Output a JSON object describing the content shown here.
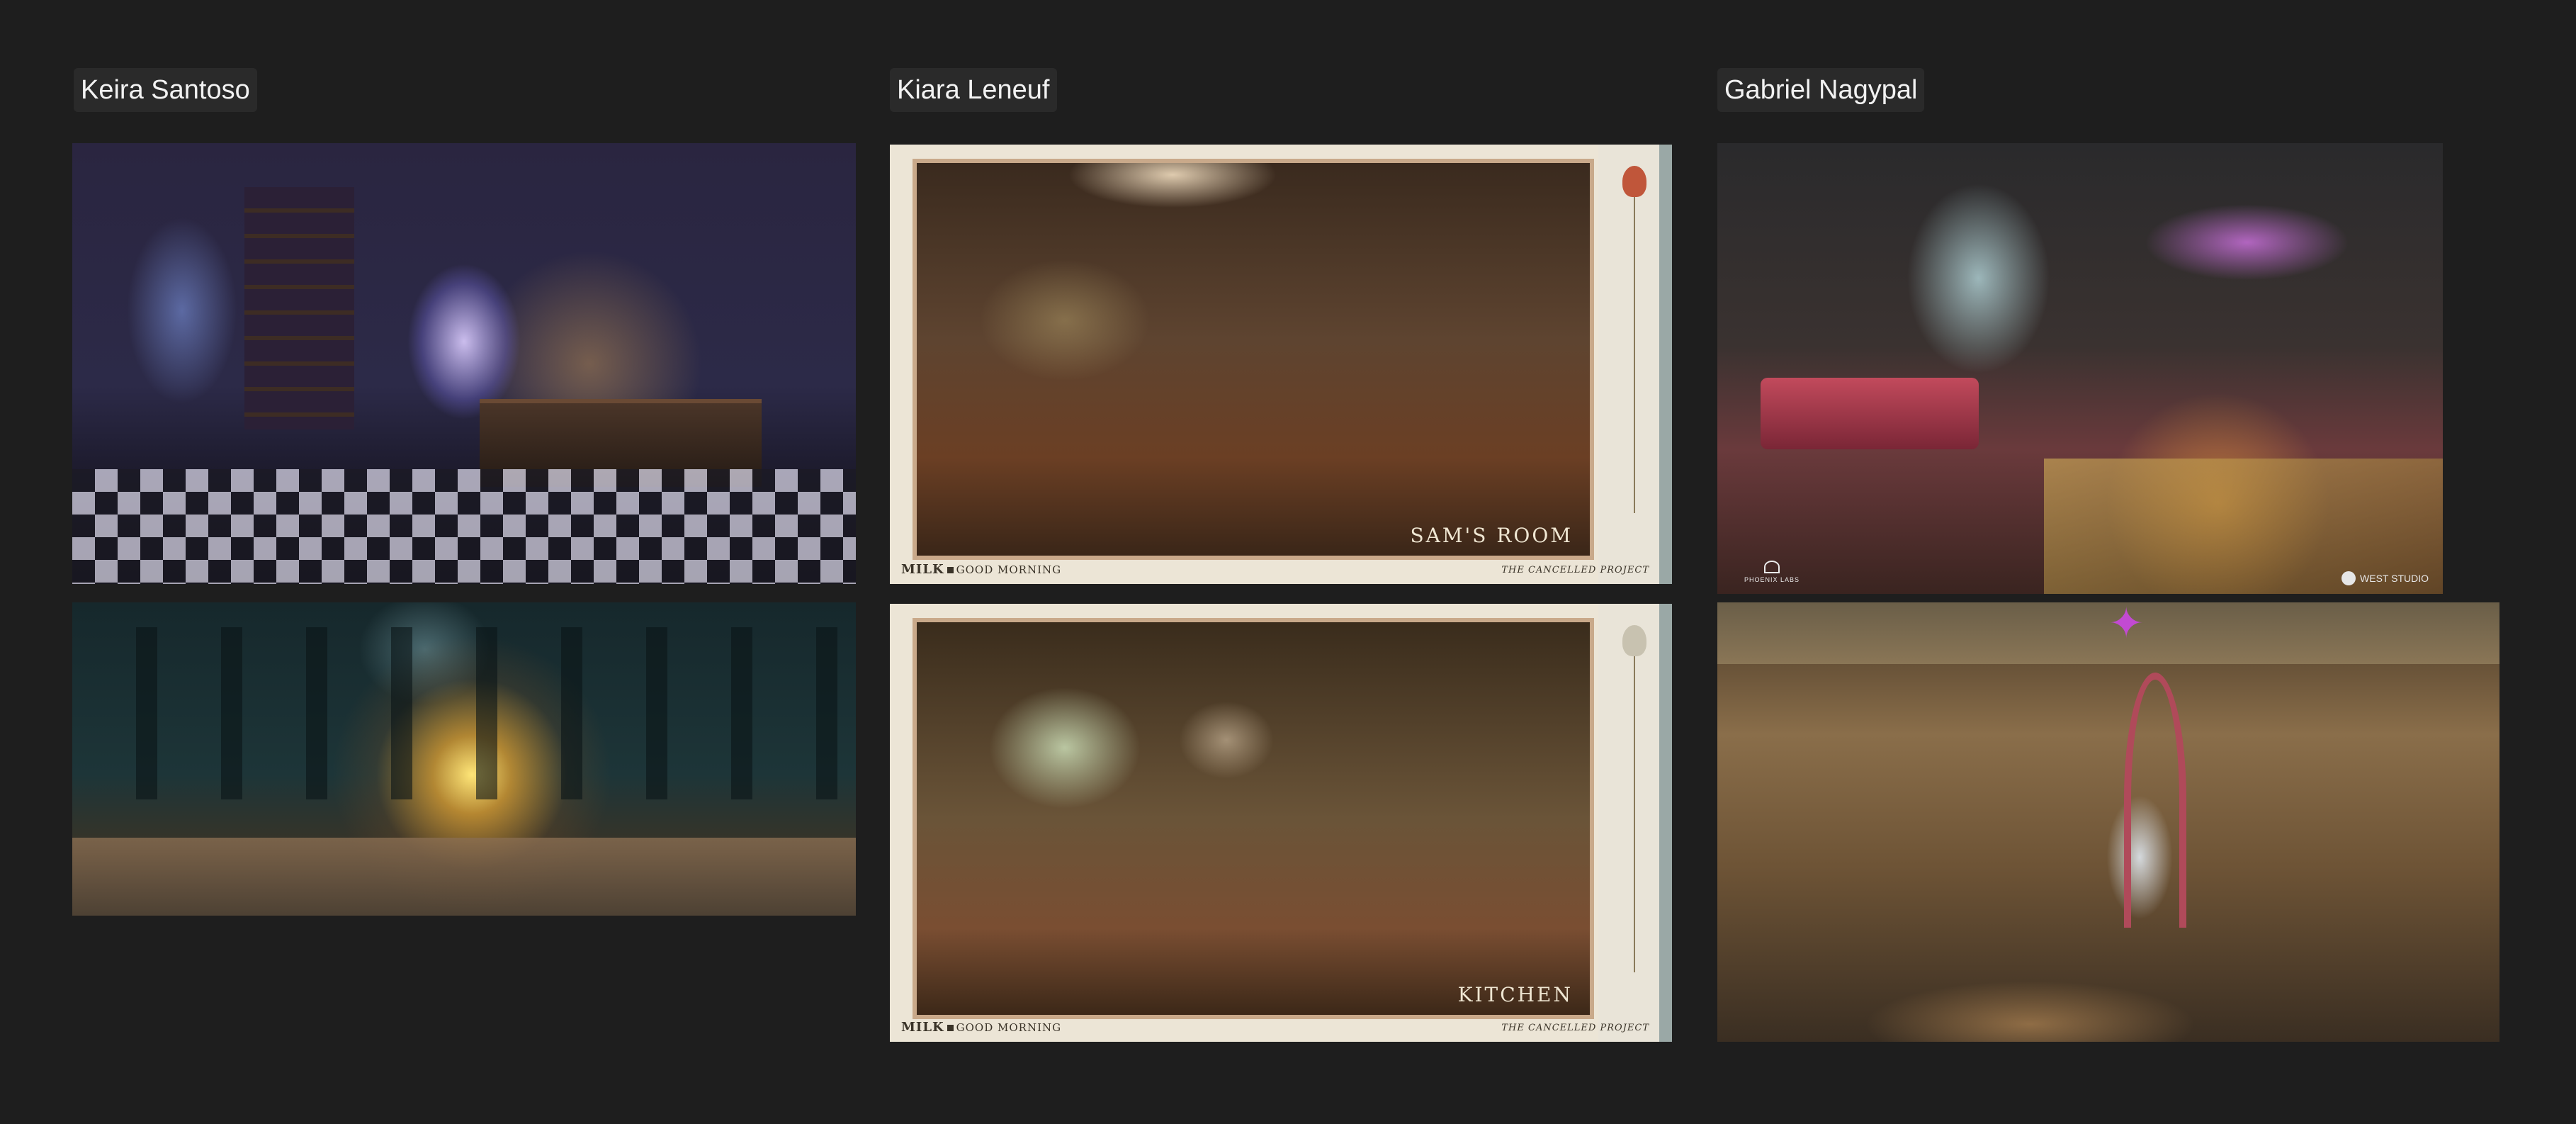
{
  "board": {
    "columns": [
      {
        "label": "Keira Santoso"
      },
      {
        "label": "Kiara Leneuf"
      },
      {
        "label": "Gabriel Nagypal"
      }
    ]
  },
  "kiara_cards": [
    {
      "caption": "SAM'S ROOM",
      "brand": "MILK",
      "subtitle": "GOOD MORNING",
      "project": "THE CANCELLED PROJECT"
    },
    {
      "caption": "KITCHEN",
      "brand": "MILK",
      "subtitle": "GOOD MORNING",
      "project": "THE CANCELLED PROJECT"
    }
  ],
  "gabriel_art_1": {
    "logo_left": "PHOENIX LABS",
    "logo_right": "WEST STUDIO"
  },
  "colors": {
    "background": "#1e1e1e",
    "label_bg": "#2a2a2a",
    "label_text": "#f2f2f2",
    "card_paper": "#ece5d6"
  }
}
